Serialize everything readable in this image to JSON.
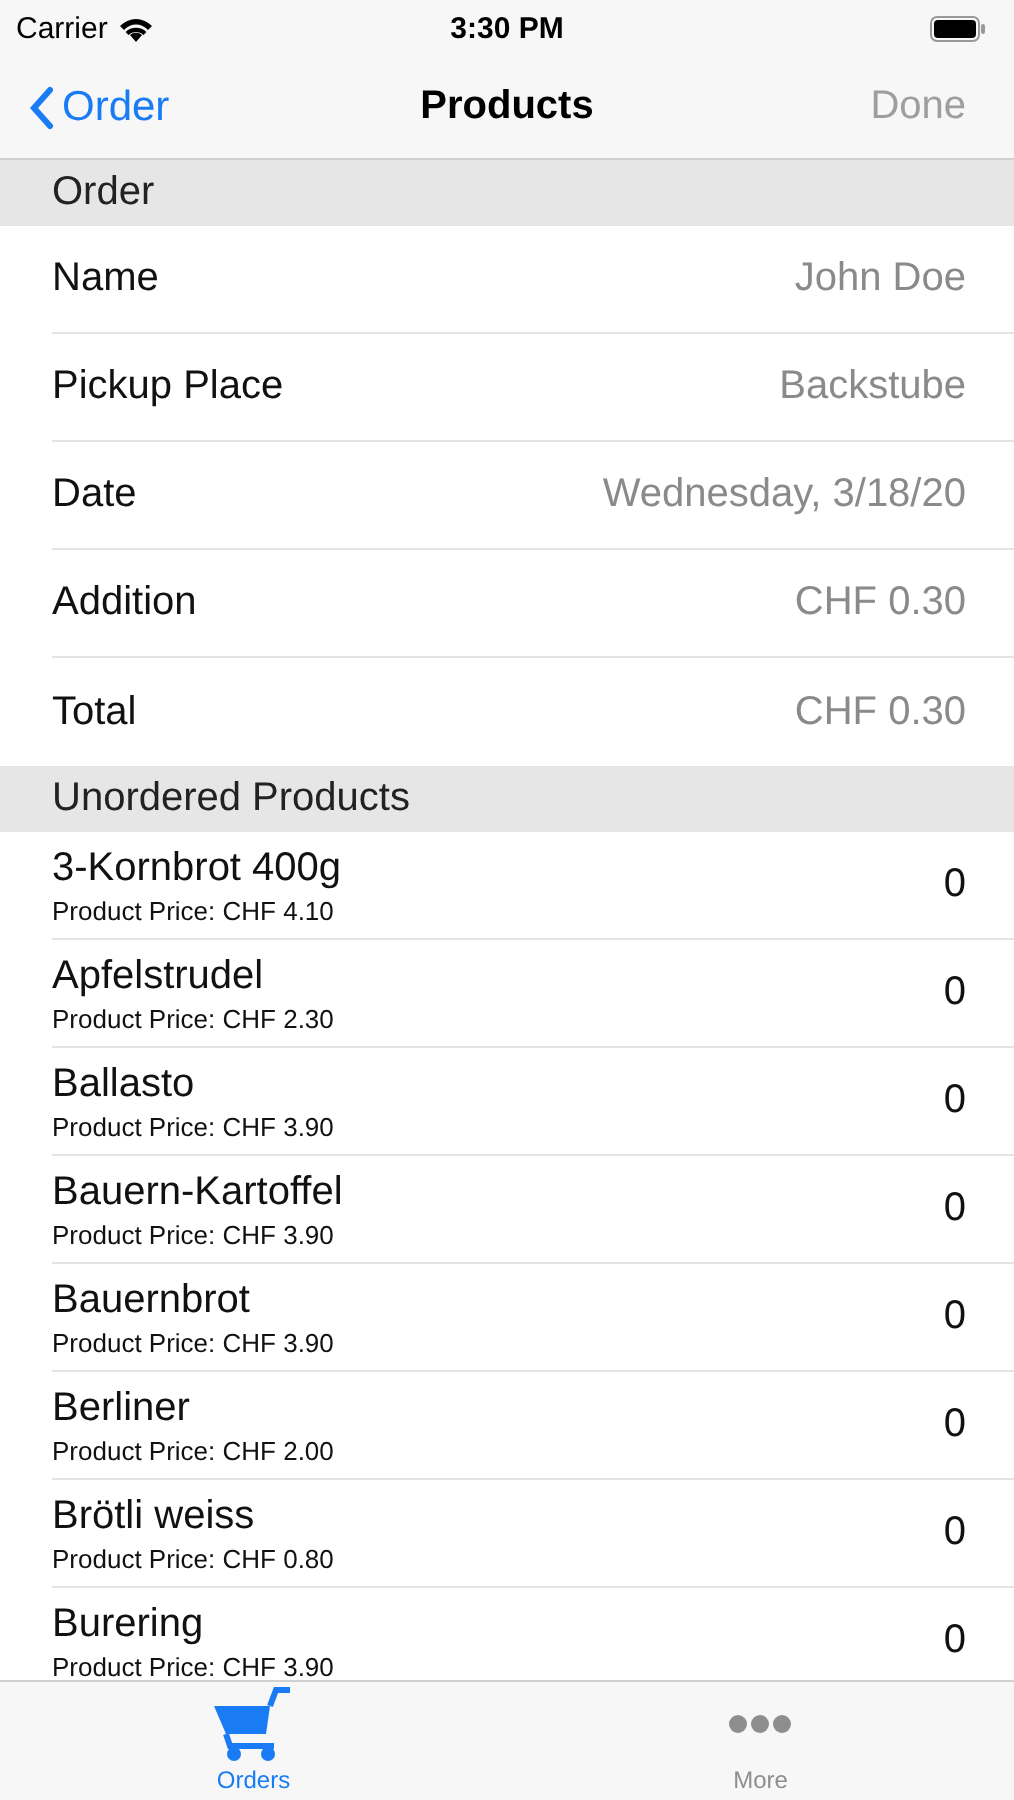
{
  "status_bar": {
    "carrier": "Carrier",
    "time": "3:30 PM"
  },
  "nav_bar": {
    "back": "Order",
    "title": "Products",
    "action": {
      "label": "Done",
      "disabled": true
    }
  },
  "order_section": {
    "header": "Order",
    "rows": [
      {
        "label": "Name",
        "value": "John Doe"
      },
      {
        "label": "Pickup Place",
        "value": "Backstube"
      },
      {
        "label": "Date",
        "value": "Wednesday, 3/18/20"
      },
      {
        "label": "Addition",
        "value": "CHF 0.30"
      },
      {
        "label": "Total",
        "value": "CHF 0.30"
      }
    ]
  },
  "products_section": {
    "header": "Unordered Products",
    "rows": [
      {
        "name": "3-Kornbrot 400g",
        "price": "Product Price: CHF 4.10",
        "quantity": "0"
      },
      {
        "name": "Apfelstrudel",
        "price": "Product Price: CHF 2.30",
        "quantity": "0"
      },
      {
        "name": "Ballasto",
        "price": "Product Price: CHF 3.90",
        "quantity": "0"
      },
      {
        "name": "Bauern-Kartoffel",
        "price": "Product Price: CHF 3.90",
        "quantity": "0"
      },
      {
        "name": "Bauernbrot",
        "price": "Product Price: CHF 3.90",
        "quantity": "0"
      },
      {
        "name": "Berliner",
        "price": "Product Price: CHF 2.00",
        "quantity": "0"
      },
      {
        "name": "Brötli weiss",
        "price": "Product Price: CHF 0.80",
        "quantity": "0"
      },
      {
        "name": "Burering",
        "price": "Product Price: CHF 3.90",
        "quantity": "0"
      }
    ]
  },
  "tab_bar": [
    {
      "label": "Orders",
      "kind": "cart",
      "selected": true
    },
    {
      "label": "More",
      "kind": "more",
      "selected": false
    }
  ]
}
